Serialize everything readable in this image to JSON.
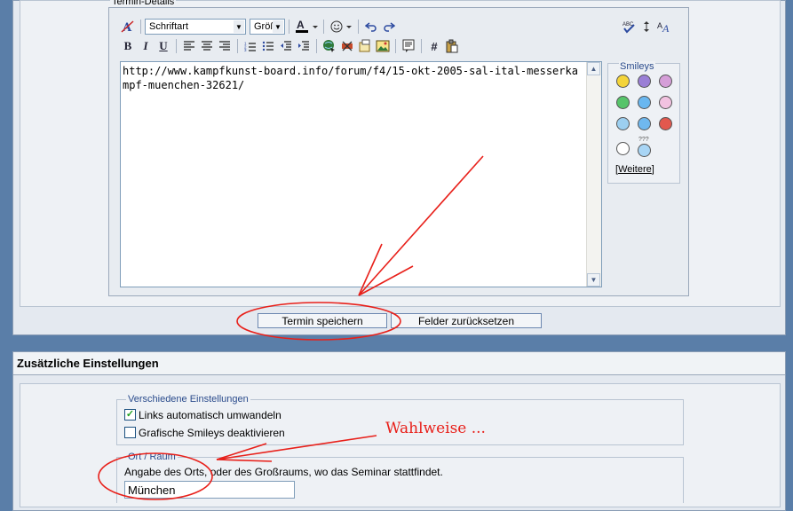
{
  "window": {
    "termin_legend": "Termin-Details"
  },
  "toolbar": {
    "font_select": "Schriftart",
    "size_select": "Größ",
    "format_clear_icon": "format-clear-icon",
    "bold": "B",
    "italic": "I",
    "underline": "U",
    "hash": "#"
  },
  "editor": {
    "content": "http://www.kampfkunst-board.info/forum/f4/15-okt-2005-sal-ital-messerkampf-muenchen-32621/"
  },
  "smileys": {
    "title": "Smileys",
    "more_label": "Weitere",
    "more_prefix": "[",
    "more_suffix": "]",
    "extra_mark": "???"
  },
  "buttons": {
    "save": "Termin speichern",
    "reset": "Felder zurücksetzen"
  },
  "extra_settings": {
    "title": "Zusätzliche Einstellungen",
    "misc_legend": "Verschiedene Einstellungen",
    "auto_links_label": "Links automatisch umwandeln",
    "auto_links_checked": true,
    "auto_links_mark": "✓",
    "disable_smileys_label": "Grafische Smileys deaktivieren",
    "disable_smileys_checked": false,
    "place_legend": "Ort / Raum",
    "place_help": "Angabe des Orts, oder des Großraums, wo das Seminar stattfindet.",
    "place_value": "München"
  },
  "annotation": {
    "note": "Wahlweise ...",
    "color": "#e8201a"
  }
}
